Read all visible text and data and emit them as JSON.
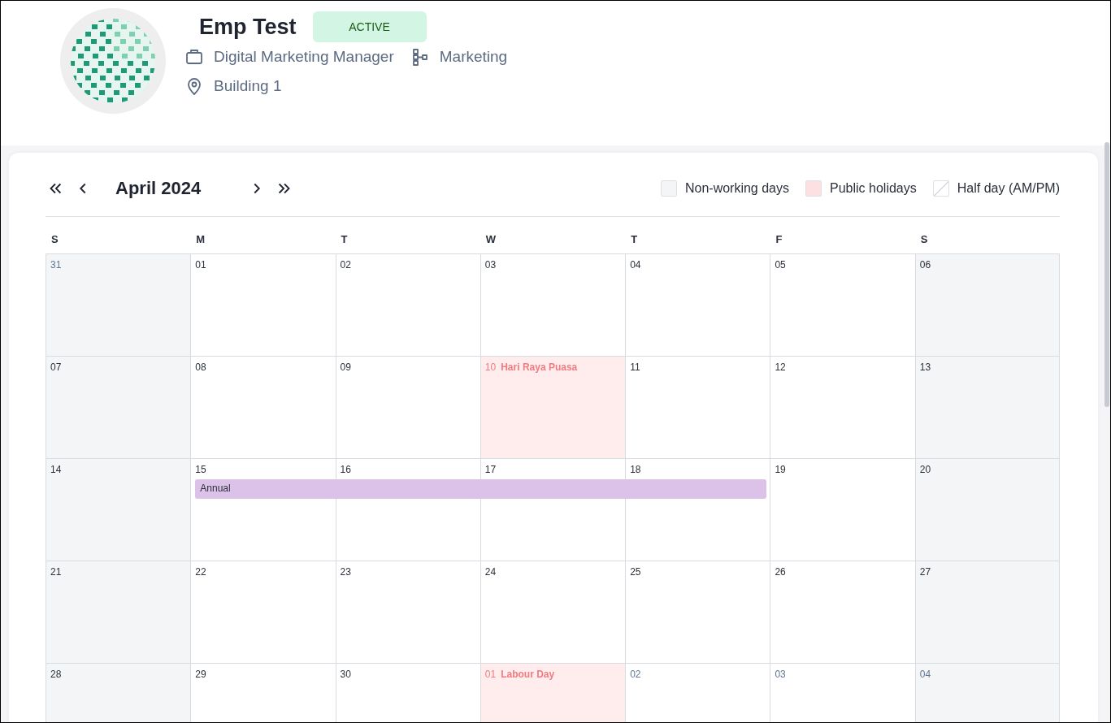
{
  "profile": {
    "name": "Emp Test",
    "status": "ACTIVE",
    "job_title": "Digital Marketing Manager",
    "department": "Marketing",
    "location": "Building 1"
  },
  "calendar": {
    "month_label": "April 2024",
    "legend": [
      {
        "kind": "non_working",
        "label": "Non-working days"
      },
      {
        "kind": "holiday",
        "label": "Public holidays"
      },
      {
        "kind": "half_day",
        "label": "Half day (AM/PM)"
      }
    ],
    "weekdays": [
      "S",
      "M",
      "T",
      "W",
      "T",
      "F",
      "S"
    ],
    "weeks": [
      {
        "days": [
          {
            "day": "31",
            "kind": "non_working",
            "outside": true,
            "on_leave": false
          },
          {
            "day": "01",
            "kind": "workday",
            "outside": false,
            "on_leave": false
          },
          {
            "day": "02",
            "kind": "workday",
            "outside": false,
            "on_leave": false
          },
          {
            "day": "03",
            "kind": "workday",
            "outside": false,
            "on_leave": false
          },
          {
            "day": "04",
            "kind": "workday",
            "outside": false,
            "on_leave": false
          },
          {
            "day": "05",
            "kind": "workday",
            "outside": false,
            "on_leave": false
          },
          {
            "day": "06",
            "kind": "non_working",
            "outside": false,
            "on_leave": false
          }
        ]
      },
      {
        "days": [
          {
            "day": "07",
            "kind": "non_working",
            "outside": false,
            "on_leave": false
          },
          {
            "day": "08",
            "kind": "workday",
            "outside": false,
            "on_leave": false
          },
          {
            "day": "09",
            "kind": "workday",
            "outside": false,
            "on_leave": false
          },
          {
            "day": "10",
            "kind": "holiday",
            "on_leave": false,
            "holiday": "Hari Raya Puasa"
          },
          {
            "day": "11",
            "kind": "workday",
            "outside": false,
            "on_leave": false
          },
          {
            "day": "12",
            "kind": "workday",
            "outside": false,
            "on_leave": false
          },
          {
            "day": "13",
            "kind": "non_working",
            "outside": false,
            "on_leave": false
          }
        ]
      },
      {
        "days": [
          {
            "day": "14",
            "kind": "non_working",
            "outside": false,
            "on_leave": false
          },
          {
            "day": "15",
            "kind": "workday",
            "outside": false,
            "on_leave": true
          },
          {
            "day": "16",
            "kind": "workday",
            "outside": false,
            "on_leave": true
          },
          {
            "day": "17",
            "kind": "workday",
            "outside": false,
            "on_leave": true
          },
          {
            "day": "18",
            "kind": "workday",
            "outside": false,
            "on_leave": true
          },
          {
            "day": "19",
            "kind": "workday",
            "outside": false,
            "on_leave": false
          },
          {
            "day": "20",
            "kind": "non_working",
            "outside": false,
            "on_leave": false
          }
        ],
        "leave": {
          "label": "Annual",
          "color": "#dcc1e8"
        }
      },
      {
        "days": [
          {
            "day": "21",
            "kind": "non_working",
            "outside": false,
            "on_leave": false
          },
          {
            "day": "22",
            "kind": "workday",
            "outside": false,
            "on_leave": false
          },
          {
            "day": "23",
            "kind": "workday",
            "outside": false,
            "on_leave": false
          },
          {
            "day": "24",
            "kind": "workday",
            "outside": false,
            "on_leave": false
          },
          {
            "day": "25",
            "kind": "workday",
            "outside": false,
            "on_leave": false
          },
          {
            "day": "26",
            "kind": "workday",
            "outside": false,
            "on_leave": false
          },
          {
            "day": "27",
            "kind": "non_working",
            "outside": false,
            "on_leave": false
          }
        ]
      },
      {
        "days": [
          {
            "day": "28",
            "kind": "non_working",
            "outside": false,
            "on_leave": false
          },
          {
            "day": "29",
            "kind": "workday",
            "outside": false,
            "on_leave": false
          },
          {
            "day": "30",
            "kind": "workday",
            "outside": false,
            "on_leave": false
          },
          {
            "day": "01",
            "kind": "holiday",
            "on_leave": false,
            "holiday": "Labour Day"
          },
          {
            "day": "02",
            "kind": "workday",
            "outside": true,
            "on_leave": false
          },
          {
            "day": "03",
            "kind": "workday",
            "outside": true,
            "on_leave": false
          },
          {
            "day": "04",
            "kind": "non_working",
            "outside": true,
            "on_leave": false
          }
        ]
      }
    ]
  }
}
